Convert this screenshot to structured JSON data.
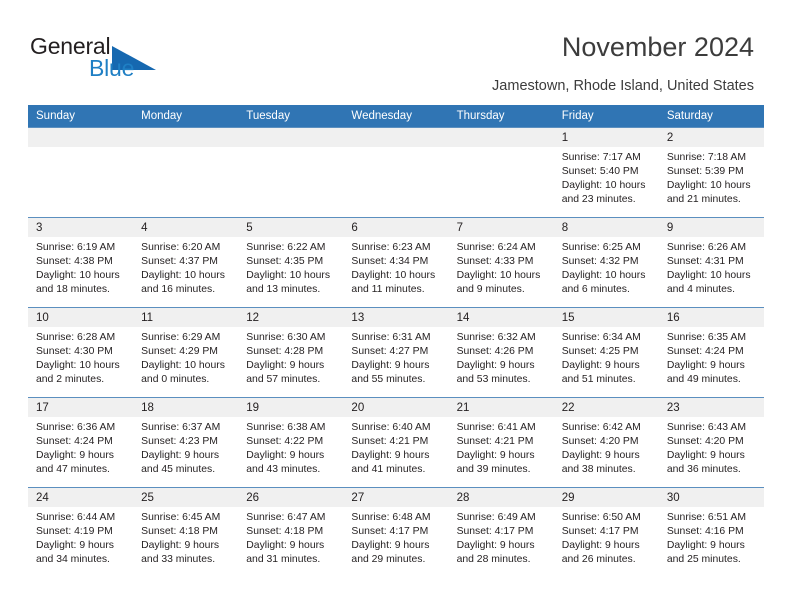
{
  "brand": {
    "name_part1": "General",
    "name_part2": "Blue",
    "accent_color": "#1668b0"
  },
  "header": {
    "title": "November 2024",
    "subtitle": "Jamestown, Rhode Island, United States"
  },
  "calendar": {
    "header_color": "#3075b4",
    "daynum_band_color": "#f0f0f0",
    "weekdays": [
      "Sunday",
      "Monday",
      "Tuesday",
      "Wednesday",
      "Thursday",
      "Friday",
      "Saturday"
    ],
    "weeks": [
      [
        {
          "day": "",
          "sunrise": "",
          "sunset": "",
          "daylight_line1": "",
          "daylight_line2": ""
        },
        {
          "day": "",
          "sunrise": "",
          "sunset": "",
          "daylight_line1": "",
          "daylight_line2": ""
        },
        {
          "day": "",
          "sunrise": "",
          "sunset": "",
          "daylight_line1": "",
          "daylight_line2": ""
        },
        {
          "day": "",
          "sunrise": "",
          "sunset": "",
          "daylight_line1": "",
          "daylight_line2": ""
        },
        {
          "day": "",
          "sunrise": "",
          "sunset": "",
          "daylight_line1": "",
          "daylight_line2": ""
        },
        {
          "day": "1",
          "sunrise": "Sunrise: 7:17 AM",
          "sunset": "Sunset: 5:40 PM",
          "daylight_line1": "Daylight: 10 hours",
          "daylight_line2": "and 23 minutes."
        },
        {
          "day": "2",
          "sunrise": "Sunrise: 7:18 AM",
          "sunset": "Sunset: 5:39 PM",
          "daylight_line1": "Daylight: 10 hours",
          "daylight_line2": "and 21 minutes."
        }
      ],
      [
        {
          "day": "3",
          "sunrise": "Sunrise: 6:19 AM",
          "sunset": "Sunset: 4:38 PM",
          "daylight_line1": "Daylight: 10 hours",
          "daylight_line2": "and 18 minutes."
        },
        {
          "day": "4",
          "sunrise": "Sunrise: 6:20 AM",
          "sunset": "Sunset: 4:37 PM",
          "daylight_line1": "Daylight: 10 hours",
          "daylight_line2": "and 16 minutes."
        },
        {
          "day": "5",
          "sunrise": "Sunrise: 6:22 AM",
          "sunset": "Sunset: 4:35 PM",
          "daylight_line1": "Daylight: 10 hours",
          "daylight_line2": "and 13 minutes."
        },
        {
          "day": "6",
          "sunrise": "Sunrise: 6:23 AM",
          "sunset": "Sunset: 4:34 PM",
          "daylight_line1": "Daylight: 10 hours",
          "daylight_line2": "and 11 minutes."
        },
        {
          "day": "7",
          "sunrise": "Sunrise: 6:24 AM",
          "sunset": "Sunset: 4:33 PM",
          "daylight_line1": "Daylight: 10 hours",
          "daylight_line2": "and 9 minutes."
        },
        {
          "day": "8",
          "sunrise": "Sunrise: 6:25 AM",
          "sunset": "Sunset: 4:32 PM",
          "daylight_line1": "Daylight: 10 hours",
          "daylight_line2": "and 6 minutes."
        },
        {
          "day": "9",
          "sunrise": "Sunrise: 6:26 AM",
          "sunset": "Sunset: 4:31 PM",
          "daylight_line1": "Daylight: 10 hours",
          "daylight_line2": "and 4 minutes."
        }
      ],
      [
        {
          "day": "10",
          "sunrise": "Sunrise: 6:28 AM",
          "sunset": "Sunset: 4:30 PM",
          "daylight_line1": "Daylight: 10 hours",
          "daylight_line2": "and 2 minutes."
        },
        {
          "day": "11",
          "sunrise": "Sunrise: 6:29 AM",
          "sunset": "Sunset: 4:29 PM",
          "daylight_line1": "Daylight: 10 hours",
          "daylight_line2": "and 0 minutes."
        },
        {
          "day": "12",
          "sunrise": "Sunrise: 6:30 AM",
          "sunset": "Sunset: 4:28 PM",
          "daylight_line1": "Daylight: 9 hours",
          "daylight_line2": "and 57 minutes."
        },
        {
          "day": "13",
          "sunrise": "Sunrise: 6:31 AM",
          "sunset": "Sunset: 4:27 PM",
          "daylight_line1": "Daylight: 9 hours",
          "daylight_line2": "and 55 minutes."
        },
        {
          "day": "14",
          "sunrise": "Sunrise: 6:32 AM",
          "sunset": "Sunset: 4:26 PM",
          "daylight_line1": "Daylight: 9 hours",
          "daylight_line2": "and 53 minutes."
        },
        {
          "day": "15",
          "sunrise": "Sunrise: 6:34 AM",
          "sunset": "Sunset: 4:25 PM",
          "daylight_line1": "Daylight: 9 hours",
          "daylight_line2": "and 51 minutes."
        },
        {
          "day": "16",
          "sunrise": "Sunrise: 6:35 AM",
          "sunset": "Sunset: 4:24 PM",
          "daylight_line1": "Daylight: 9 hours",
          "daylight_line2": "and 49 minutes."
        }
      ],
      [
        {
          "day": "17",
          "sunrise": "Sunrise: 6:36 AM",
          "sunset": "Sunset: 4:24 PM",
          "daylight_line1": "Daylight: 9 hours",
          "daylight_line2": "and 47 minutes."
        },
        {
          "day": "18",
          "sunrise": "Sunrise: 6:37 AM",
          "sunset": "Sunset: 4:23 PM",
          "daylight_line1": "Daylight: 9 hours",
          "daylight_line2": "and 45 minutes."
        },
        {
          "day": "19",
          "sunrise": "Sunrise: 6:38 AM",
          "sunset": "Sunset: 4:22 PM",
          "daylight_line1": "Daylight: 9 hours",
          "daylight_line2": "and 43 minutes."
        },
        {
          "day": "20",
          "sunrise": "Sunrise: 6:40 AM",
          "sunset": "Sunset: 4:21 PM",
          "daylight_line1": "Daylight: 9 hours",
          "daylight_line2": "and 41 minutes."
        },
        {
          "day": "21",
          "sunrise": "Sunrise: 6:41 AM",
          "sunset": "Sunset: 4:21 PM",
          "daylight_line1": "Daylight: 9 hours",
          "daylight_line2": "and 39 minutes."
        },
        {
          "day": "22",
          "sunrise": "Sunrise: 6:42 AM",
          "sunset": "Sunset: 4:20 PM",
          "daylight_line1": "Daylight: 9 hours",
          "daylight_line2": "and 38 minutes."
        },
        {
          "day": "23",
          "sunrise": "Sunrise: 6:43 AM",
          "sunset": "Sunset: 4:20 PM",
          "daylight_line1": "Daylight: 9 hours",
          "daylight_line2": "and 36 minutes."
        }
      ],
      [
        {
          "day": "24",
          "sunrise": "Sunrise: 6:44 AM",
          "sunset": "Sunset: 4:19 PM",
          "daylight_line1": "Daylight: 9 hours",
          "daylight_line2": "and 34 minutes."
        },
        {
          "day": "25",
          "sunrise": "Sunrise: 6:45 AM",
          "sunset": "Sunset: 4:18 PM",
          "daylight_line1": "Daylight: 9 hours",
          "daylight_line2": "and 33 minutes."
        },
        {
          "day": "26",
          "sunrise": "Sunrise: 6:47 AM",
          "sunset": "Sunset: 4:18 PM",
          "daylight_line1": "Daylight: 9 hours",
          "daylight_line2": "and 31 minutes."
        },
        {
          "day": "27",
          "sunrise": "Sunrise: 6:48 AM",
          "sunset": "Sunset: 4:17 PM",
          "daylight_line1": "Daylight: 9 hours",
          "daylight_line2": "and 29 minutes."
        },
        {
          "day": "28",
          "sunrise": "Sunrise: 6:49 AM",
          "sunset": "Sunset: 4:17 PM",
          "daylight_line1": "Daylight: 9 hours",
          "daylight_line2": "and 28 minutes."
        },
        {
          "day": "29",
          "sunrise": "Sunrise: 6:50 AM",
          "sunset": "Sunset: 4:17 PM",
          "daylight_line1": "Daylight: 9 hours",
          "daylight_line2": "and 26 minutes."
        },
        {
          "day": "30",
          "sunrise": "Sunrise: 6:51 AM",
          "sunset": "Sunset: 4:16 PM",
          "daylight_line1": "Daylight: 9 hours",
          "daylight_line2": "and 25 minutes."
        }
      ]
    ]
  }
}
